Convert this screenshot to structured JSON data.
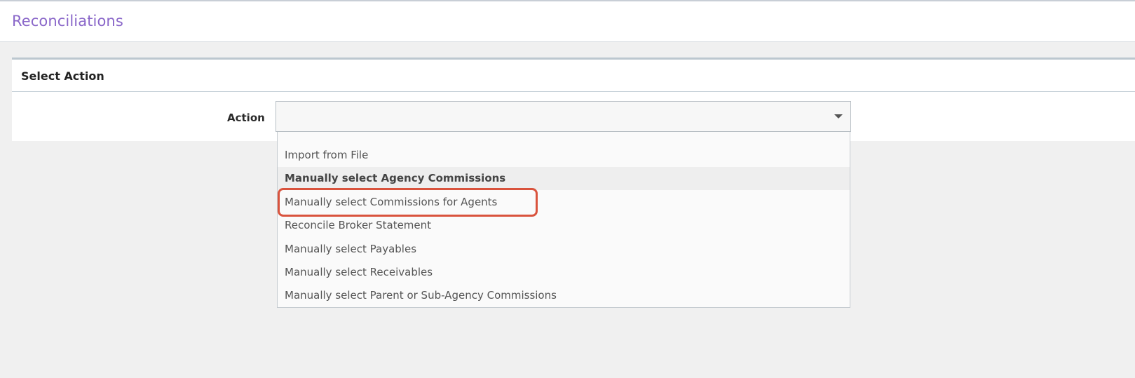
{
  "header": {
    "title": "Reconciliations"
  },
  "panel": {
    "title": "Select Action",
    "action_label": "Action",
    "action_value": ""
  },
  "dropdown": {
    "options": [
      "Import from File",
      "Manually select Agency Commissions",
      "Manually select Commissions for Agents",
      "Reconcile Broker Statement",
      "Manually select Payables",
      "Manually select Receivables",
      "Manually select Parent or Sub-Agency Commissions"
    ],
    "hovered_option": "Manually select Agency Commissions",
    "annotated_option": "Manually select Commissions for Agents"
  },
  "colors": {
    "title_accent": "#8a67c9",
    "annotation_ring": "#d9533d"
  },
  "icons": {
    "select_caret": "caret-down-icon"
  }
}
